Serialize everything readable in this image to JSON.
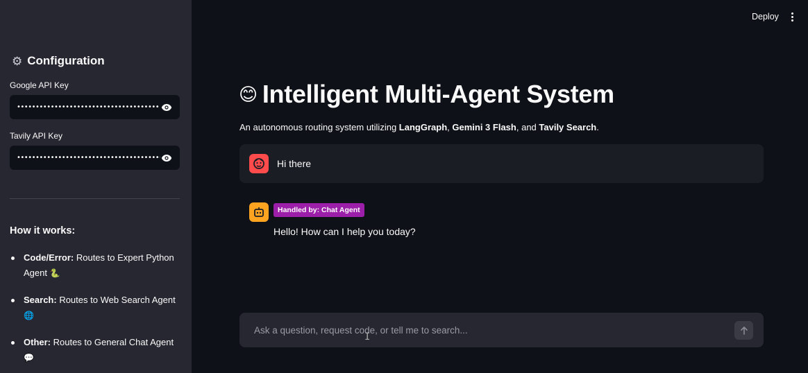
{
  "sidebar": {
    "config_title": "Configuration",
    "gear_icon": "gear-icon",
    "google_label": "Google API Key",
    "google_value": "••••••••••••••••••••••••••••••••••••••",
    "tavily_label": "Tavily API Key",
    "tavily_value": "•••••••••••••••••••••••••••••••••••••••••••",
    "how_title": "How it works:",
    "items": [
      {
        "bold": "Code/Error:",
        "text": " Routes to Expert Python Agent",
        "emoji": "🐍"
      },
      {
        "bold": "Search:",
        "text": " Routes to Web Search Agent",
        "emoji": "🌐"
      },
      {
        "bold": "Other:",
        "text": " Routes to General Chat Agent",
        "emoji": "💬"
      }
    ]
  },
  "header": {
    "deploy_label": "Deploy"
  },
  "main": {
    "title_emoji": "😊",
    "title": "Intelligent Multi-Agent System",
    "subtitle_prefix": "An autonomous routing system utilizing ",
    "subtitle_b1": "LangGraph",
    "subtitle_sep1": ", ",
    "subtitle_b2": "Gemini 3 Flash",
    "subtitle_sep2": ", and ",
    "subtitle_b3": "Tavily Search",
    "subtitle_end": "."
  },
  "messages": {
    "user_text": "Hi there",
    "user_avatar": "😶",
    "bot_avatar": "🤖",
    "bot_badge": "Handled by: Chat Agent",
    "bot_text": "Hello! How can I help you today?"
  },
  "chat_input": {
    "placeholder": "Ask a question, request code, or tell me to search..."
  },
  "colors": {
    "sidebar_bg": "#262730",
    "main_bg": "#0e1117",
    "user_avatar_bg": "#ff4b4b",
    "bot_avatar_bg": "#ffa421",
    "badge_bg": "#9b1fa8"
  }
}
